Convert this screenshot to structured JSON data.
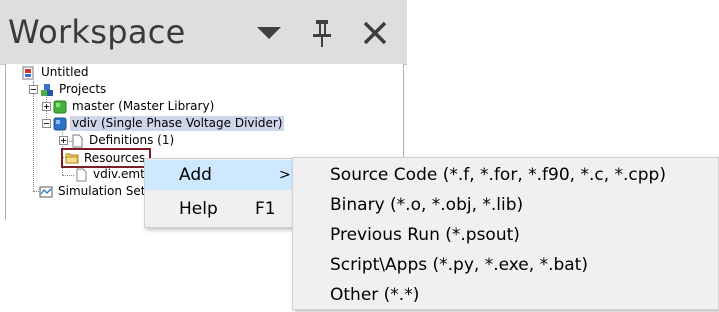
{
  "workspace": {
    "title": "Workspace",
    "buttons": {
      "dropdown": "chevron-down-icon",
      "pin": "pin-icon",
      "close": "close-icon"
    }
  },
  "tree": {
    "items": [
      {
        "label": "Untitled",
        "icon": "project-icon"
      },
      {
        "label": "Projects",
        "icon": "projects-icon"
      },
      {
        "label": "master (Master Library)",
        "icon": "library-icon"
      },
      {
        "label": "vdiv (Single Phase Voltage Divider)",
        "icon": "project-cube-icon"
      },
      {
        "label": "Definitions (1)",
        "icon": "document-icon"
      },
      {
        "label": "Resources",
        "icon": "folder-icon"
      },
      {
        "label": "vdiv.emt",
        "icon": "file-icon"
      },
      {
        "label": "Simulation Sets",
        "icon": "simulation-icon"
      }
    ]
  },
  "context_menu": {
    "items": [
      {
        "label": "Add",
        "shortcut": "",
        "submenu": ">"
      },
      {
        "label": "Help",
        "shortcut": "F1",
        "submenu": ""
      }
    ]
  },
  "submenu": {
    "items": [
      "Source Code (*.f, *.for, *.f90, *.c, *.cpp)",
      "Binary (*.o, *.obj, *.lib)",
      "Previous Run (*.psout)",
      "Script\\Apps (*.py, *.exe, *.bat)",
      "Other (*.*)"
    ]
  },
  "colors": {
    "header_bg": "#dedede",
    "selection_bg": "#cfd6ea",
    "highlight_border": "#7a1f28",
    "menu_bg": "#f0f0f0",
    "menu_hover_bg": "#cde8ff"
  }
}
